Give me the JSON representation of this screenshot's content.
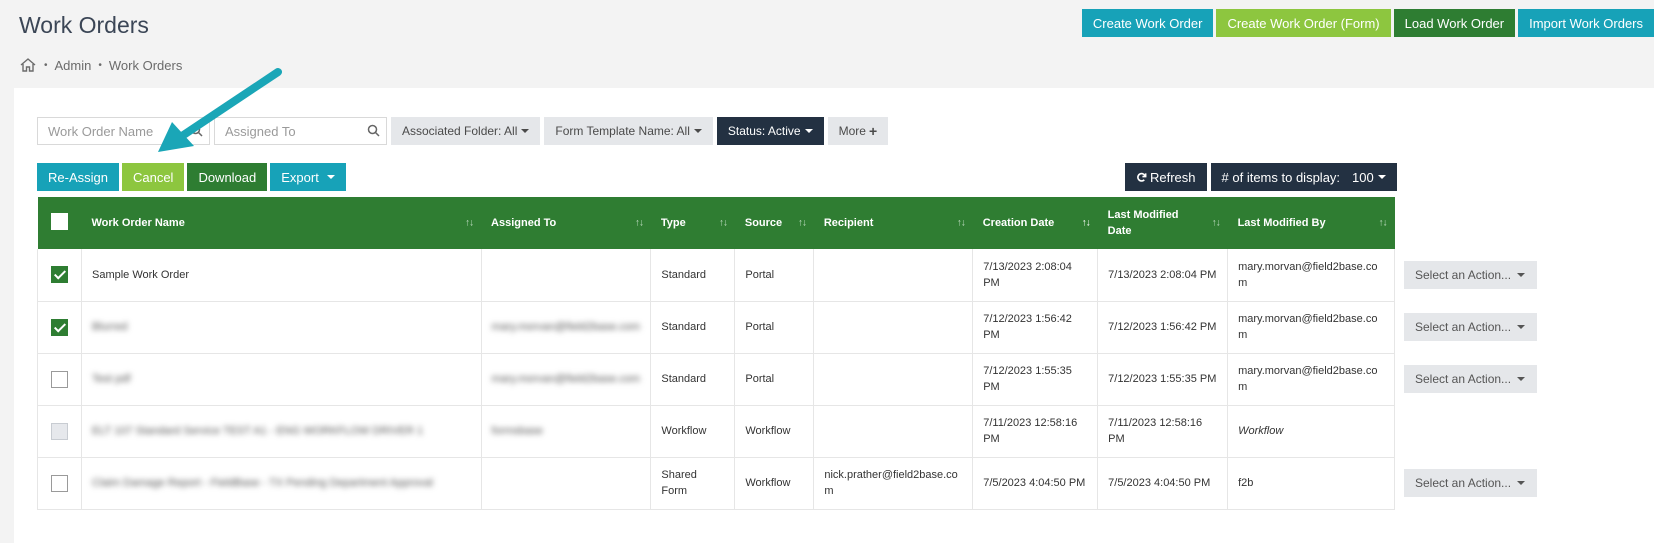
{
  "page": {
    "title": "Work Orders"
  },
  "breadcrumb": {
    "items": [
      "Admin",
      "Work Orders"
    ],
    "sep": "•"
  },
  "top_actions": [
    {
      "label": "Create Work Order",
      "color": "#17a2b8"
    },
    {
      "label": "Create Work Order (Form)",
      "color": "#8dc63f"
    },
    {
      "label": "Load Work Order",
      "color": "#2e7d32"
    },
    {
      "label": "Import Work Orders",
      "color": "#17a2b8"
    }
  ],
  "filters": {
    "work_order_name_placeholder": "Work Order Name",
    "assigned_to_placeholder": "Assigned To",
    "associated_folder": "Associated Folder: All",
    "form_template": "Form Template Name: All",
    "status": "Status: Active",
    "more": "More"
  },
  "actions": {
    "reassign": "Re-Assign",
    "cancel": "Cancel",
    "download": "Download",
    "export": "Export",
    "refresh": "Refresh",
    "items_label": "# of items to display:",
    "items_value": "100"
  },
  "table": {
    "headers": [
      "Work Order Name",
      "Assigned To",
      "Type",
      "Source",
      "Recipient",
      "Creation Date",
      "Last Modified Date",
      "Last Modified By"
    ],
    "rows": [
      {
        "checked": true,
        "name": "Sample Work Order",
        "assigned": "",
        "type": "Standard",
        "source": "Portal",
        "recipient": "",
        "created": "7/13/2023 2:08:04 PM",
        "modified": "7/13/2023 2:08:04 PM",
        "modified_by": "mary.morvan@field2base.com",
        "action": "Select an Action..."
      },
      {
        "checked": true,
        "name": "Blurred",
        "assigned": "mary.morvan@field2base.com",
        "type": "Standard",
        "source": "Portal",
        "recipient": "",
        "created": "7/12/2023 1:56:42 PM",
        "modified": "7/12/2023 1:56:42 PM",
        "modified_by": "mary.morvan@field2base.com",
        "action": "Select an Action..."
      },
      {
        "checked": false,
        "name": "Test pdf",
        "assigned": "mary.morvan@field2base.com",
        "type": "Standard",
        "source": "Portal",
        "recipient": "",
        "created": "7/12/2023 1:55:35 PM",
        "modified": "7/12/2023 1:55:35 PM",
        "modified_by": "mary.morvan@field2base.com",
        "action": "Select an Action..."
      },
      {
        "checked": false,
        "disabled": true,
        "name": "ELT 107 Standard Service TEST A1 - ENG WORKFLOW DRIVER 1",
        "assigned": "formsbase",
        "type": "Workflow",
        "source": "Workflow",
        "recipient": "",
        "created": "7/11/2023 12:58:16 PM",
        "modified": "7/11/2023 12:58:16 PM",
        "modified_by": "Workflow",
        "action": ""
      },
      {
        "checked": false,
        "name": "Claim Damage Report - FieldBase - TX Pending Department Approval",
        "assigned": "",
        "type": "Shared Form",
        "source": "Workflow",
        "recipient": "nick.prather@field2base.com",
        "created": "7/5/2023 4:04:50 PM",
        "modified": "7/5/2023 4:04:50 PM",
        "modified_by": "f2b",
        "action": "Select an Action..."
      }
    ]
  },
  "icons": {
    "home": "home-icon",
    "search": "search-icon",
    "refresh": "refresh-icon",
    "plus": "plus-icon",
    "sort": "sort-icon"
  }
}
